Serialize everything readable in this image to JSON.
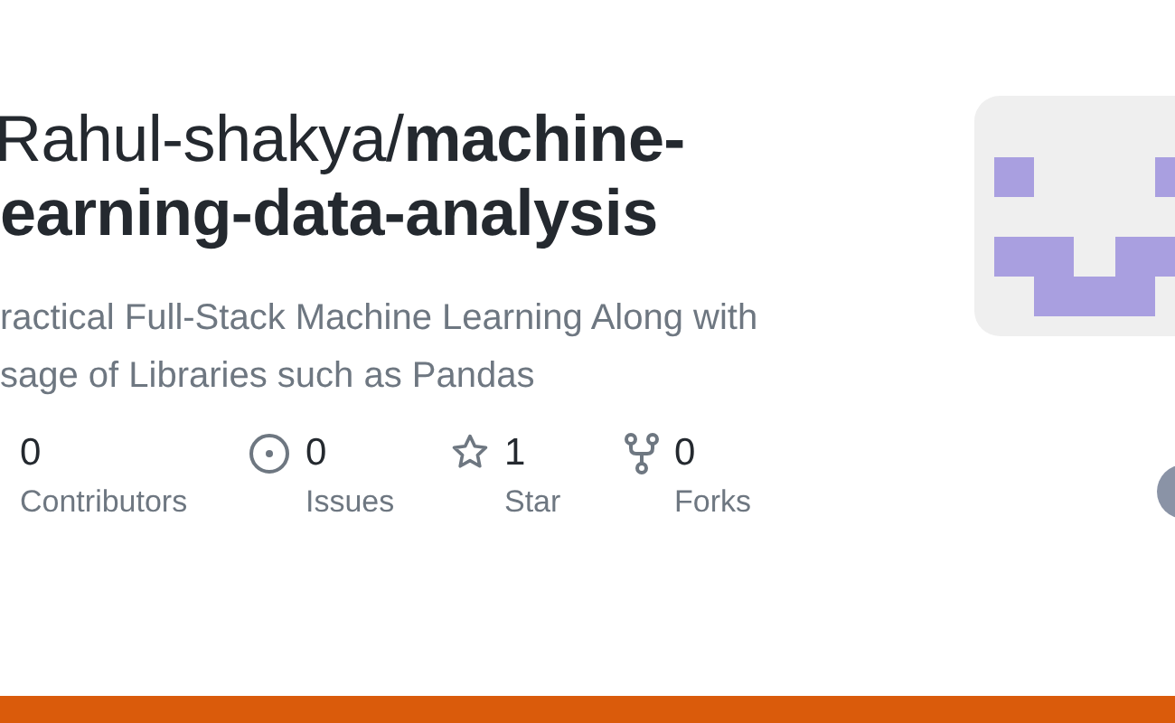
{
  "title_lines": [
    "Rahul-shakya/**machine-**",
    "**earning-data-analysis**"
  ],
  "description_lines": [
    "ractical Full-Stack Machine Learning Along with",
    "sage of Libraries such as Pandas"
  ],
  "stats": [
    {
      "kind": "contributors",
      "value": "0",
      "label": "Contributors"
    },
    {
      "kind": "issues",
      "value": "0",
      "label": "Issues"
    },
    {
      "kind": "stars",
      "value": "1",
      "label": "Star"
    },
    {
      "kind": "forks",
      "value": "0",
      "label": "Forks"
    }
  ]
}
